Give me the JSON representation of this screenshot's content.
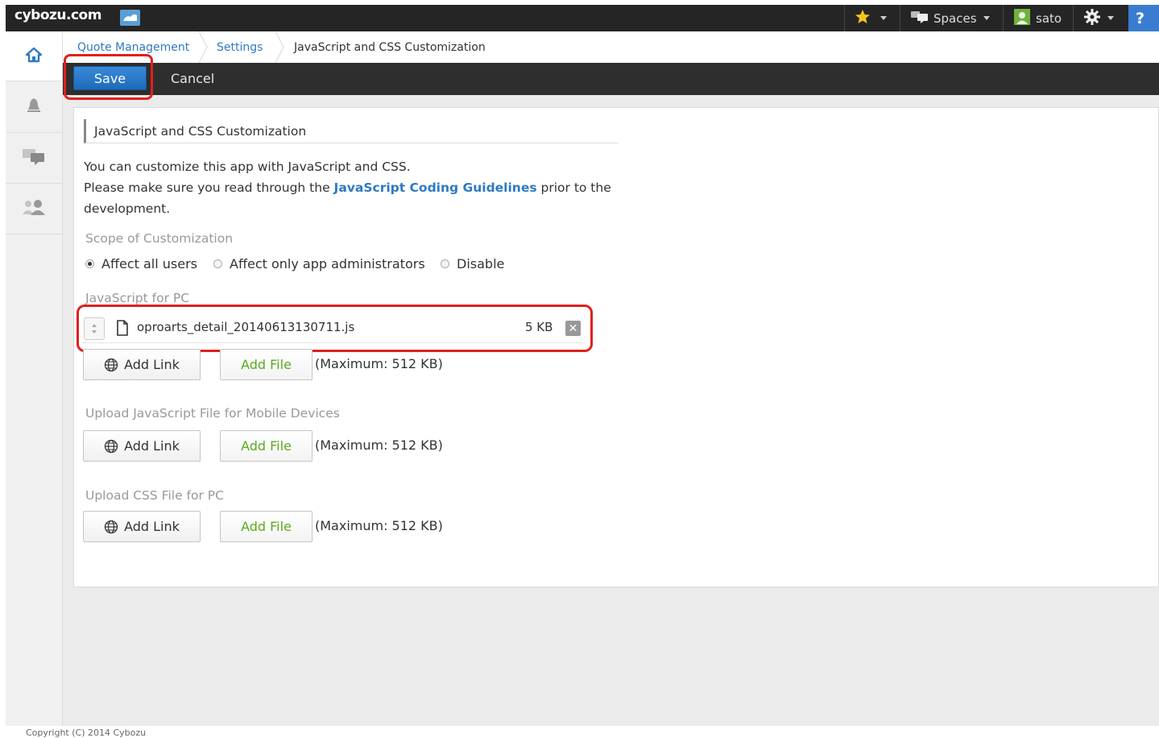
{
  "header": {
    "logo_text": "cybozu.com",
    "spaces_label": "Spaces",
    "user_name": "sato",
    "help_label": "?"
  },
  "breadcrumb": {
    "items": [
      "Quote Management",
      "Settings",
      "JavaScript and CSS Customization"
    ]
  },
  "actions": {
    "save_label": "Save",
    "cancel_label": "Cancel"
  },
  "section": {
    "title": "JavaScript and CSS Customization",
    "intro_line1": "You can customize this app with JavaScript and CSS.",
    "intro_line2_pre": "Please make sure you read through the ",
    "intro_link": "JavaScript Coding Guidelines",
    "intro_line2_post": " prior to the",
    "intro_line3": "development."
  },
  "scope": {
    "label": "Scope of Customization",
    "options": [
      "Affect all users",
      "Affect only app administrators",
      "Disable"
    ],
    "selected": "Affect all users"
  },
  "js_pc": {
    "label": "JavaScript for PC",
    "file_name": "oproarts_detail_20140613130711.js",
    "file_size": "5 KB",
    "add_link_label": "Add Link",
    "add_file_label": "Add File",
    "max_text": "(Maximum: 512 KB)"
  },
  "js_mobile": {
    "label": "Upload JavaScript File for Mobile Devices",
    "add_link_label": "Add Link",
    "add_file_label": "Add File",
    "max_text": "(Maximum: 512 KB)"
  },
  "css_pc": {
    "label": "Upload CSS File for PC",
    "add_link_label": "Add Link",
    "add_file_label": "Add File",
    "max_text": "(Maximum: 512 KB)"
  },
  "footer": {
    "copyright": "Copyright (C) 2014 Cybozu"
  },
  "colors": {
    "save_blue": "#1d6ab9",
    "link_blue": "#2f7ac2",
    "add_file_green": "#5aab1f",
    "highlight_red": "#e0211c"
  }
}
